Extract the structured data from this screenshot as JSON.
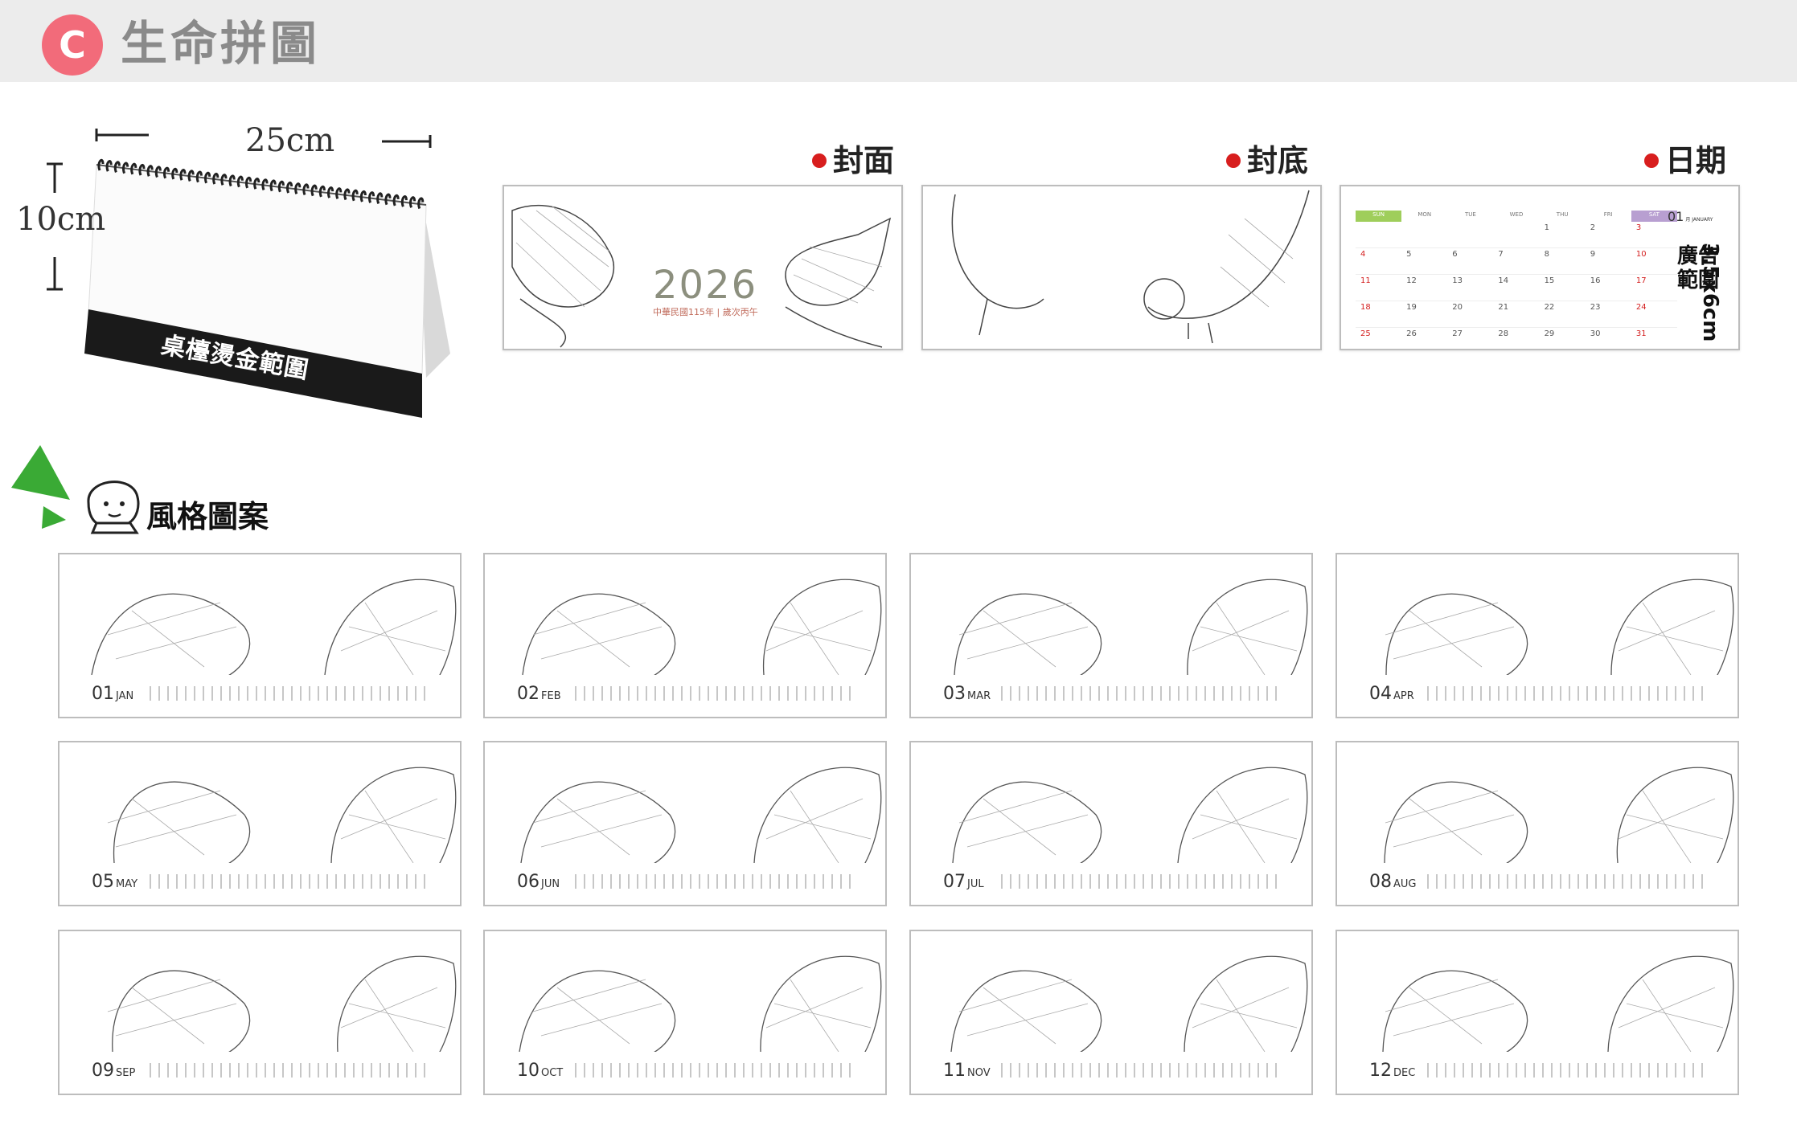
{
  "header": {
    "badge": "C",
    "title": "生命拼圖"
  },
  "desk": {
    "width_label": "25cm",
    "height_label": "10cm",
    "stamp_label": "桌檯燙金範圍"
  },
  "previews": {
    "cover": {
      "label": "封面",
      "year": "2026",
      "sub": "中華民國115年 | 歲次丙午"
    },
    "back": {
      "label": "封底"
    },
    "date": {
      "label": "日期",
      "month": "01",
      "month_sub": "月 JANUARY",
      "days_head": [
        "SUN",
        "MON",
        "TUE",
        "WED",
        "THU",
        "FRI",
        "SAT"
      ],
      "rows": [
        [
          "",
          "",
          "",
          "",
          "1",
          "2",
          "3"
        ],
        [
          "4",
          "5",
          "6",
          "7",
          "8",
          "9",
          "10"
        ],
        [
          "11",
          "12",
          "13",
          "14",
          "15",
          "16",
          "17"
        ],
        [
          "18",
          "19",
          "20",
          "21",
          "22",
          "23",
          "24"
        ],
        [
          "25",
          "26",
          "27",
          "28",
          "29",
          "30",
          "31"
        ]
      ],
      "ad_text": "廣告範圍",
      "ad_size": "3.5x6cm"
    }
  },
  "style_section": {
    "title": "風格圖案"
  },
  "months": [
    {
      "num": "01",
      "abbr": "JAN"
    },
    {
      "num": "02",
      "abbr": "FEB"
    },
    {
      "num": "03",
      "abbr": "MAR"
    },
    {
      "num": "04",
      "abbr": "APR"
    },
    {
      "num": "05",
      "abbr": "MAY"
    },
    {
      "num": "06",
      "abbr": "JUN"
    },
    {
      "num": "07",
      "abbr": "JUL"
    },
    {
      "num": "08",
      "abbr": "AUG"
    },
    {
      "num": "09",
      "abbr": "SEP"
    },
    {
      "num": "10",
      "abbr": "OCT"
    },
    {
      "num": "11",
      "abbr": "NOV"
    },
    {
      "num": "12",
      "abbr": "DEC"
    }
  ],
  "colors": {
    "badge": "#f26b7a",
    "dot": "#d81e1e",
    "triangle": "#3aaa35"
  }
}
